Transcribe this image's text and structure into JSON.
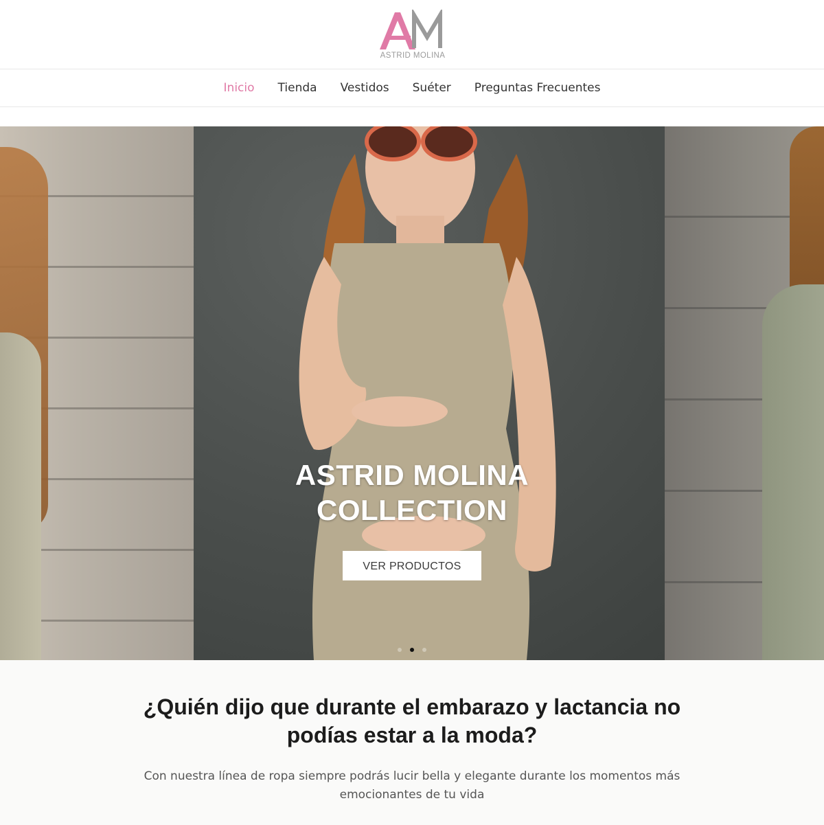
{
  "brand": {
    "logo_initials": "AM",
    "logo_name": "ASTRID MOLINA",
    "colors": {
      "accent": "#e07aa6",
      "logo_gray": "#9a9a9a"
    }
  },
  "nav": {
    "items": [
      {
        "label": "Inicio",
        "active": true
      },
      {
        "label": "Tienda",
        "active": false
      },
      {
        "label": "Vestidos",
        "active": false
      },
      {
        "label": "Suéter",
        "active": false
      },
      {
        "label": "Preguntas Frecuentes",
        "active": false
      }
    ]
  },
  "hero": {
    "title_line1": "ASTRID MOLINA",
    "title_line2": "COLLECTION",
    "button_label": "VER PRODUCTOS",
    "slides_count": 3,
    "active_slide": 2
  },
  "intro": {
    "heading": "¿Quién dijo que durante el embarazo y lactancia no podías estar a la moda?",
    "text": "Con nuestra línea de ropa siempre podrás lucir bella y elegante durante los momentos más emocionantes de tu vida"
  }
}
